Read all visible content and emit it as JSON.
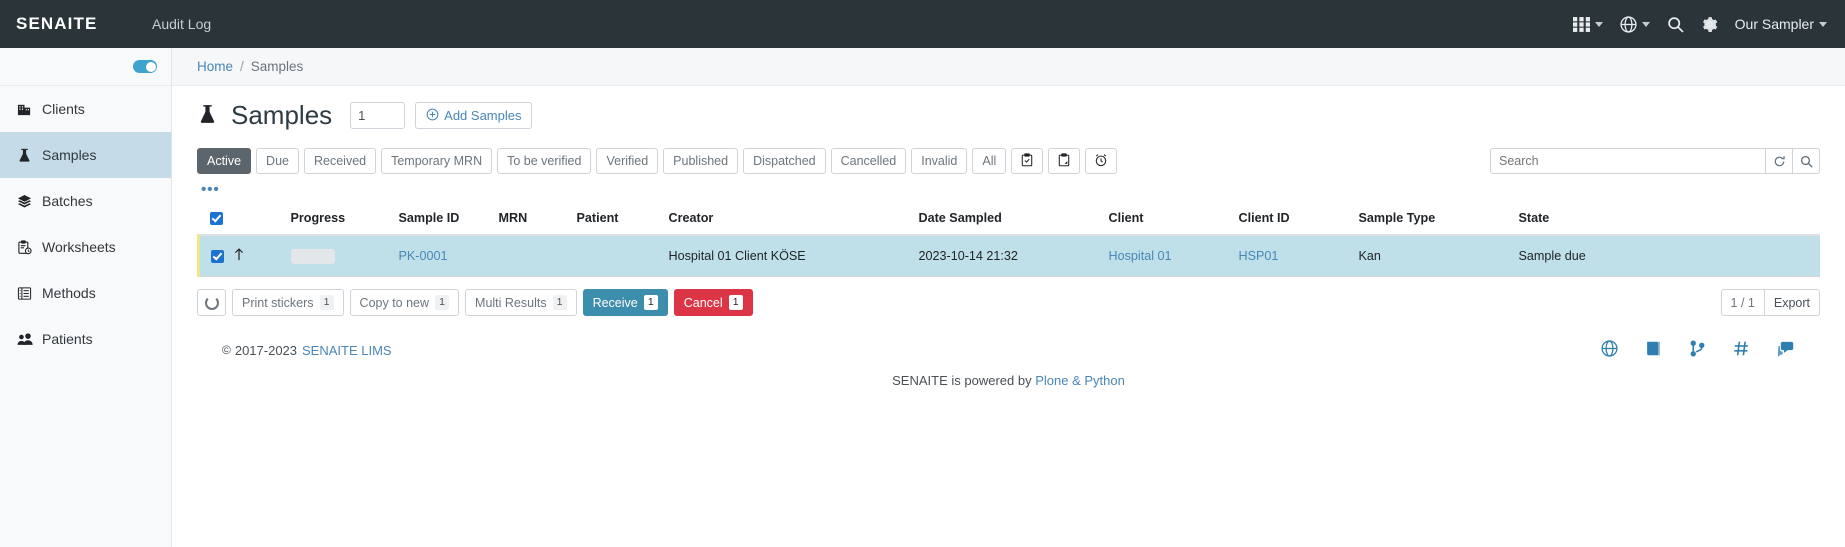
{
  "topbar": {
    "brand": "SENAITE",
    "audit_log": "Audit Log",
    "username": "Our Sampler",
    "icons": [
      "grid-apps-icon",
      "globe-icon",
      "search-icon",
      "gear-icon"
    ]
  },
  "sidebar": {
    "items": [
      {
        "label": "Clients",
        "icon": "building-icon",
        "active": false
      },
      {
        "label": "Samples",
        "icon": "flask-icon",
        "active": true
      },
      {
        "label": "Batches",
        "icon": "layers-icon",
        "active": false
      },
      {
        "label": "Worksheets",
        "icon": "clipboard-clock-icon",
        "active": false
      },
      {
        "label": "Methods",
        "icon": "list-checklist-icon",
        "active": false
      },
      {
        "label": "Patients",
        "icon": "people-icon",
        "active": false
      }
    ]
  },
  "breadcrumb": {
    "home": "Home",
    "separator": "/",
    "current": "Samples"
  },
  "page": {
    "title": "Samples",
    "count_value": "1",
    "add_button": "Add Samples"
  },
  "filters": {
    "tabs": [
      {
        "label": "Active",
        "selected": true
      },
      {
        "label": "Due",
        "selected": false
      },
      {
        "label": "Received",
        "selected": false
      },
      {
        "label": "Temporary MRN",
        "selected": false
      },
      {
        "label": "To be verified",
        "selected": false
      },
      {
        "label": "Verified",
        "selected": false
      },
      {
        "label": "Published",
        "selected": false
      },
      {
        "label": "Dispatched",
        "selected": false
      },
      {
        "label": "Cancelled",
        "selected": false
      },
      {
        "label": "Invalid",
        "selected": false
      },
      {
        "label": "All",
        "selected": false
      }
    ],
    "icon_tabs": [
      "clipboard-check-icon",
      "clipboard-page-icon",
      "alarm-clock-icon"
    ],
    "more_toggle": "•••"
  },
  "search": {
    "value": "",
    "placeholder": "Search",
    "reload_icon": "reload-icon",
    "search_icon": "search-icon"
  },
  "table": {
    "columns": [
      "",
      "",
      "Progress",
      "Sample ID",
      "MRN",
      "Patient",
      "Creator",
      "Date Sampled",
      "Client",
      "Client ID",
      "Sample Type",
      "State"
    ],
    "rows": [
      {
        "selected": true,
        "priority_icon": "up-arrow-icon",
        "progress": "",
        "sample_id": "PK-0001",
        "mrn": "",
        "patient": "",
        "creator": "Hospital 01 Client KÖSE",
        "date_sampled": "2023-10-14 21:32",
        "client": "Hospital 01",
        "client_id": "HSP01",
        "sample_type": "Kan",
        "state": "Sample due"
      }
    ]
  },
  "actions": {
    "spinner_icon": "loading-ring-icon",
    "buttons": [
      {
        "label": "Print stickers",
        "count": "1",
        "style": "default"
      },
      {
        "label": "Copy to new",
        "count": "1",
        "style": "default"
      },
      {
        "label": "Multi Results",
        "count": "1",
        "style": "default"
      },
      {
        "label": "Receive",
        "count": "1",
        "style": "primary"
      },
      {
        "label": "Cancel",
        "count": "1",
        "style": "danger"
      }
    ],
    "page_count": "1 / 1",
    "export_label": "Export"
  },
  "footer": {
    "copyright_symbol": "©",
    "copyright": "2017-2023",
    "link": "SENAITE LIMS",
    "powered_prefix": "SENAITE is powered by",
    "powered_link": "Plone & Python",
    "icons": [
      "globe-icon",
      "book-icon",
      "git-branch-icon",
      "hash-icon",
      "chat-icon"
    ]
  },
  "colors": {
    "header_bg": "#2b3539",
    "sidebar_active": "#c5dce8",
    "row_highlight": "#bfe0e8",
    "link": "#4a86b8",
    "primary": "#3d8dad",
    "danger": "#dc3545"
  }
}
